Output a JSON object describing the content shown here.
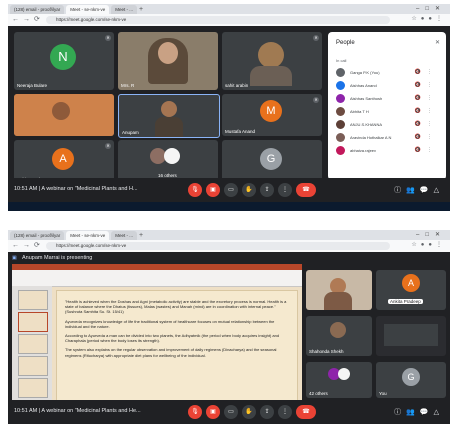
{
  "screenshot1": {
    "browser": {
      "tabs": [
        "(128) email - proof/ilyar",
        "Meet - se-nkm-ve",
        "Meet - ..."
      ],
      "url": "https://meet.google.com/se-nkm-ve"
    },
    "tiles": [
      {
        "name": "Neeraja Bulare",
        "initial": "N",
        "color": "#33a852"
      },
      {
        "name": "Mrs. R",
        "initial": "",
        "color": "#5b4a3a"
      },
      {
        "name": "sahit arabin",
        "initial": "",
        "color": "#6b5f55"
      },
      {
        "name": "",
        "initial": "",
        "color": "#c86a3a"
      },
      {
        "name": "Anupam",
        "initial": "",
        "color": "#4a3f35"
      },
      {
        "name": "Mustafa Anand",
        "initial": "M",
        "color": "#e8711c"
      },
      {
        "name": "Ankita Pradeep",
        "initial": "A",
        "color": "#e8711c"
      },
      {
        "name": "16 others",
        "initial": "",
        "color": "#3c4043"
      },
      {
        "name": "You",
        "initial": "G",
        "color": "#9aa0a6"
      }
    ],
    "people_panel": {
      "title": "People",
      "section": "In call",
      "participants": [
        {
          "name": "Ganga P.K (You)",
          "color": "#5f6368"
        },
        {
          "name": "Aishhas Anand",
          "color": "#1a73e8"
        },
        {
          "name": "Aishhas Santhosh",
          "color": "#8e24aa"
        },
        {
          "name": "Abhita T H",
          "color": "#6d4c41"
        },
        {
          "name": "ANJU.S.KHANNA",
          "color": "#5d4037"
        },
        {
          "name": "Aravinda Hothalkar A N",
          "color": "#7b5e57"
        },
        {
          "name": "abhaiva.rajeev",
          "color": "#c2185b"
        }
      ]
    },
    "bottom": {
      "meeting": "10:51 AM  |  A webinar on \"Medicinal Plants and H...",
      "end_icon": "phone-end-icon"
    }
  },
  "screenshot2": {
    "browser": {
      "tabs": [
        "(128) email - proof/ilyar",
        "Meet - se-nkm-ve",
        "Meet - ..."
      ],
      "url": "https://meet.google.com/se-nkm-ve"
    },
    "presenting": "Anupam Marrai is presenting",
    "slide_text": [
      "\"Health is achieved when the Doshas and Agni (metabolic activity) are stable and the excretory process is normal. Health is a state of balance where the Dhatus (tissues), Malas (wastes) and Manah (mind) are in coordination with internal peace.\" (Sushruta Samhita Su. St. 15/41)",
      "Ayurveda recognizes knowledge of life the traditional system of healthcare focuses on mutual relationship between the individual and the nature.",
      "According to Ayurveda a man can be divided into two planets, the Adhyatmik (the period when body acquires insight) and Charaphala (period when the body loses its strength).",
      "The system also explains on the regular observation and improvement of daily regimens (Dinacharya) and the seasonal regimens (Ritucharya) with appropriate diet plans for wellbeing of the individual."
    ],
    "tiles": [
      {
        "name": "",
        "initial": "",
        "color": "#b07a55"
      },
      {
        "name": "Ankita Pradeep",
        "initial": "A",
        "color": "#e8711c"
      },
      {
        "name": "Shahonda Shekh",
        "initial": "",
        "color": "#5b4a3a"
      },
      {
        "name": "",
        "initial": "",
        "color": "#3c4043"
      },
      {
        "name": "42 others",
        "initial": "",
        "color": "#3c4043"
      },
      {
        "name": "You",
        "initial": "G",
        "color": "#9aa0a6"
      }
    ],
    "bottom": {
      "meeting": "10:51 AM  |  A webinar on \"Medicinal Plants and He..."
    }
  }
}
